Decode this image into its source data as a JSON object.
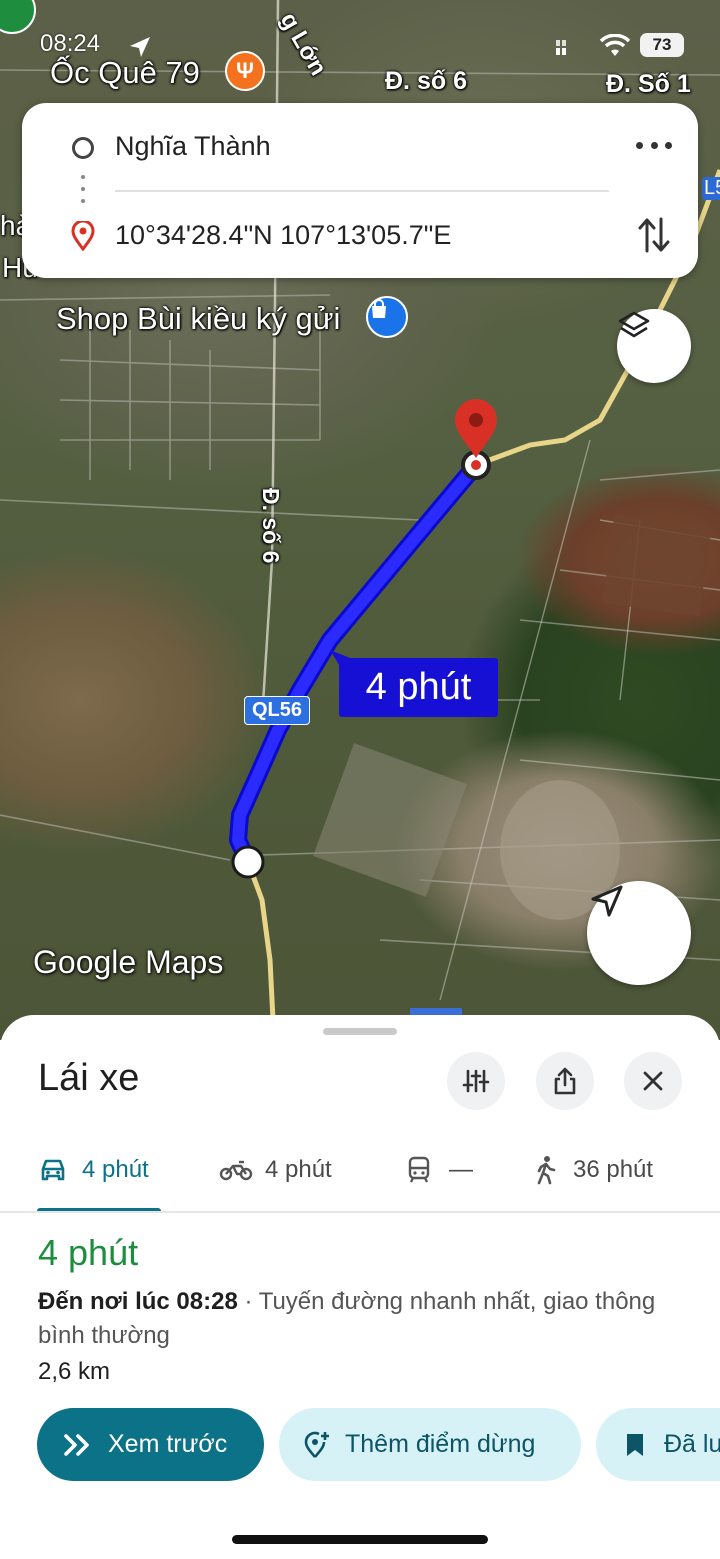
{
  "status_bar": {
    "time": "08:24",
    "battery": "73"
  },
  "map": {
    "labels": {
      "poi_restaurant": "Ốc Quê 79",
      "road_top_mid": "Đ. số 6",
      "road_top_right": "Đ. Số 1",
      "road_top_vertical": "g Lớn",
      "shop": "Shop Bùi kiều ký gửi",
      "road_left_vertical": "Đ. số 6",
      "highway": "QL56",
      "highway_right_edge": "L5",
      "partial_left_1": "hà",
      "partial_left_2": "Hu"
    },
    "route_duration_badge": "4 phút",
    "watermark": "Google Maps"
  },
  "directions_card": {
    "origin": "Nghĩa Thành",
    "destination": "10°34'28.4\"N 107°13'05.7\"E"
  },
  "sheet": {
    "title": "Lái xe",
    "modes": [
      {
        "icon": "car-icon",
        "label": "4 phút",
        "selected": true
      },
      {
        "icon": "motorbike-icon",
        "label": "4 phút",
        "selected": false
      },
      {
        "icon": "transit-icon",
        "label": "—",
        "selected": false
      },
      {
        "icon": "walk-icon",
        "label": "36 phút",
        "selected": false
      }
    ],
    "route": {
      "duration": "4 phút",
      "arrival_label": "Đến nơi lúc 08:28",
      "description": " · Tuyến đường nhanh nhất, giao thông bình thường",
      "distance": "2,6 km"
    },
    "buttons": {
      "preview": "Xem trước",
      "add_stop": "Thêm điểm dừng",
      "saved": "Đã lưu"
    }
  },
  "colors": {
    "route_blue": "#1a1aff",
    "accent_teal": "#0b7287",
    "green_duration": "#1e8e3e",
    "pin_red": "#d93025"
  }
}
